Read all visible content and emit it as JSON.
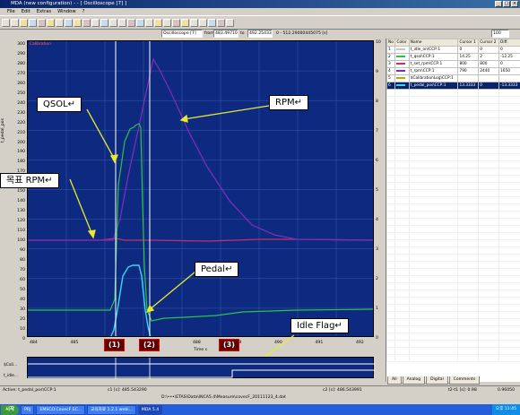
{
  "window": {
    "title": "MDA (new configuration) - - [ Oscilloscope [7] ]"
  },
  "menu": [
    "File",
    "Edit",
    "Extras",
    "Window",
    "?"
  ],
  "scope_bar": {
    "instrument": "Oscilloscope [7]",
    "from_label": "from",
    "from_value": "483.49710",
    "to_label": "to",
    "to_value": "492.25433",
    "range_text": "0 - 512.29000445075 [s]",
    "zoom": "100"
  },
  "axis_left": {
    "name": "t_pedal_pos",
    "ticks": [
      "300",
      "290",
      "280",
      "270",
      "260",
      "250",
      "240",
      "230",
      "220",
      "210",
      "200",
      "190",
      "180",
      "170",
      "160",
      "150",
      "140",
      "130",
      "120",
      "110",
      "100",
      "90",
      "80",
      "70",
      "60",
      "50",
      "40",
      "30",
      "20",
      "10",
      "0"
    ]
  },
  "axis_right": {
    "ticks": [
      "10",
      "9",
      "8",
      "7",
      "6",
      "5",
      "4",
      "3",
      "2",
      "1",
      "0"
    ]
  },
  "axis_x": {
    "ticks": [
      "484",
      "485",
      "486",
      "487",
      "488",
      "489",
      "490",
      "491",
      "492"
    ],
    "label": "Time s"
  },
  "plot_header": {
    "text": "Calibration"
  },
  "annotations": {
    "qsol": "QSOL↵",
    "rpm": "RPM↵",
    "target_rpm": "목표 RPM↵",
    "pedal": "Pedal↵",
    "idle_flag": "Idle Flag↵"
  },
  "markers": [
    "(1)",
    "(2)",
    "(3)"
  ],
  "digital_labels": [
    "$Cali...",
    "t_idle..."
  ],
  "signal_table": {
    "columns": [
      "No",
      "Color",
      "Name",
      "Cursor 1",
      "Cursor 2",
      "Diff."
    ],
    "rows": [
      {
        "no": "1",
        "name": "t_idle_on\\CCP:1",
        "c1": "0",
        "c2": "0",
        "diff": "0"
      },
      {
        "no": "2",
        "name": "t_qsol\\CCP:1",
        "c1": "14.25",
        "c2": "2",
        "diff": "-12.25"
      },
      {
        "no": "3",
        "name": "t_set_rpm\\CCP:1",
        "c1": "800",
        "c2": "800",
        "diff": "0"
      },
      {
        "no": "4",
        "name": "t_rpm\\CCP:1",
        "c1": "790",
        "c2": "2440",
        "diff": "1650"
      },
      {
        "no": "5",
        "name": "$CalibrationLog\\CCP:1",
        "c1": "",
        "c2": "",
        "diff": ""
      },
      {
        "no": "6",
        "name": "t_pedal_pos\\CCP:1",
        "c1": "13.3333",
        "c2": "0",
        "diff": "-13.3333"
      }
    ]
  },
  "right_tabs": [
    "All",
    "Analog",
    "Digital",
    "Comments"
  ],
  "status": {
    "active": "Active: t_pedal_pos\\CCP:1",
    "c1": "c1 [s]: 485.543290",
    "c2": "c2 [s]: 486.543991",
    "diff": "t2-t1 [s]: 0.98",
    "extra": "0.96050"
  },
  "path": "D:\\•••\\ETAS\\Data\\INCA5.4\\Measure\\covecF_20111123_4.dat",
  "taskbar": {
    "start": "시작",
    "tasks": [
      "PRJ",
      "EMSCO:CovecF EC...",
      "교육자료 1.2.1 webi...",
      "MDA 5.4"
    ],
    "clock": "오후 11:45"
  },
  "colors": {
    "plot_bg": "#0d2a80",
    "rpm": "#7a2db8",
    "target_rpm": "#c03070",
    "qsol": "#2ec24a",
    "pedal": "#34d8f2",
    "annotation_arrow": "#e8ea2e",
    "cursor": "#ffffff"
  }
}
